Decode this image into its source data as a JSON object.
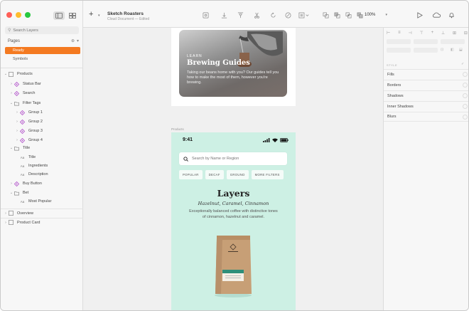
{
  "sidebar": {
    "search_placeholder": "Search Layers",
    "pages_label": "Pages",
    "pages": [
      {
        "label": "Ready",
        "selected": true
      },
      {
        "label": "Symbols",
        "selected": false
      }
    ],
    "layers": [
      {
        "label": "Products",
        "indent": 0,
        "icon": "artboard-icon",
        "expanded": true
      },
      {
        "label": "Status Bar",
        "indent": 1,
        "icon": "symbol-icon",
        "expanded": false
      },
      {
        "label": "Search",
        "indent": 1,
        "icon": "symbol-icon",
        "expanded": false
      },
      {
        "label": "Filter Tags",
        "indent": 1,
        "icon": "folder-icon",
        "expanded": true
      },
      {
        "label": "Group 1",
        "indent": 2,
        "icon": "symbol-icon",
        "expanded": false
      },
      {
        "label": "Group 2",
        "indent": 2,
        "icon": "symbol-icon",
        "expanded": false
      },
      {
        "label": "Group 3",
        "indent": 2,
        "icon": "symbol-icon",
        "expanded": false
      },
      {
        "label": "Group 4",
        "indent": 2,
        "icon": "symbol-icon",
        "expanded": false
      },
      {
        "label": "Title",
        "indent": 1,
        "icon": "folder-icon",
        "expanded": true
      },
      {
        "label": "Title",
        "indent": 2,
        "icon": "text-icon",
        "expanded": false
      },
      {
        "label": "Ingredients",
        "indent": 2,
        "icon": "text-icon",
        "expanded": false
      },
      {
        "label": "Description",
        "indent": 2,
        "icon": "text-icon",
        "expanded": false
      },
      {
        "label": "Buy Button",
        "indent": 1,
        "icon": "symbol-icon",
        "expanded": false
      },
      {
        "label": "Bet",
        "indent": 1,
        "icon": "folder-icon",
        "expanded": true
      },
      {
        "label": "Most Popular",
        "indent": 2,
        "icon": "text-icon",
        "expanded": false
      },
      {
        "label": "Overview",
        "indent": 0,
        "icon": "artboard-icon",
        "expanded": false
      },
      {
        "label": "Product Card",
        "indent": 0,
        "icon": "artboard-icon",
        "expanded": false
      }
    ]
  },
  "toolbar": {
    "add_label": "+",
    "doc_title": "Sketch Roasters",
    "doc_subtitle": "Cloud Document — Edited",
    "zoom": "100%"
  },
  "canvas": {
    "card": {
      "eyebrow": "LEARN",
      "title": "Brewing Guides",
      "description": "Taking our beans home with you? Our guides tell you how to make the most of them, however you're brewing."
    },
    "product_label": "Products",
    "product": {
      "time": "9:41",
      "search_placeholder": "Search by Name or Region",
      "filters": [
        "POPULAR",
        "DECAF",
        "GROUND",
        "MORE FILTERS"
      ],
      "title": "Layers",
      "subtitle": "Hazelnut, Caramel, Cinnamon",
      "description": "Exceptionally balanced coffee with distinctive tones of cinnamon, hazelnut and caramel."
    }
  },
  "inspector": {
    "style_label": "STYLE",
    "sections": [
      "Fills",
      "Borders",
      "Shadows",
      "Inner Shadows",
      "Blurs"
    ]
  },
  "colors": {
    "accent": "#f47a21",
    "product_bg": "#cdf0e4",
    "tag_bg": "#2f8f7a"
  }
}
